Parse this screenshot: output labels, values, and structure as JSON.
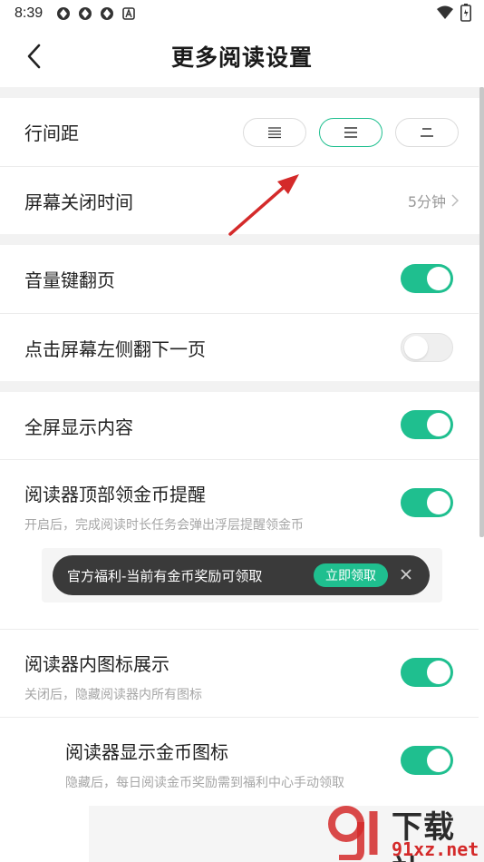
{
  "status_bar": {
    "time": "8:39",
    "icons": [
      "app-icon",
      "app-icon",
      "app-icon",
      "a-badge-icon"
    ],
    "right_icons": [
      "wifi-icon",
      "battery-icon"
    ]
  },
  "header": {
    "title": "更多阅读设置",
    "back_icon": "chevron-left-icon"
  },
  "settings": {
    "line_spacing": {
      "label": "行间距",
      "options": [
        "tight",
        "medium",
        "loose"
      ],
      "selected_index": 1
    },
    "screen_off": {
      "label": "屏幕关闭时间",
      "value": "5分钟"
    },
    "volume_page": {
      "label": "音量键翻页",
      "enabled": true
    },
    "tap_left": {
      "label": "点击屏幕左侧翻下一页",
      "enabled": false
    },
    "fullscreen": {
      "label": "全屏显示内容",
      "enabled": true
    },
    "gold_reminder": {
      "label": "阅读器顶部领金币提醒",
      "desc": "开启后，完成阅读时长任务会弹出浮层提醒领金币",
      "enabled": true
    },
    "toast_preview": {
      "text": "官方福利-当前有金币奖励可领取",
      "button": "立即领取"
    },
    "icon_display": {
      "label": "阅读器内图标展示",
      "desc": "关闭后，隐藏阅读器内所有图标",
      "enabled": true
    },
    "gold_icon": {
      "label": "阅读器显示金币图标",
      "desc": "隐藏后，每日阅读金币奖励需到福利中心手动领取",
      "enabled": true
    }
  },
  "colors": {
    "accent": "#1fbf8f",
    "annotation_arrow": "#d42a2a"
  },
  "watermark": {
    "title": "下载站",
    "url": "91xz.net"
  }
}
